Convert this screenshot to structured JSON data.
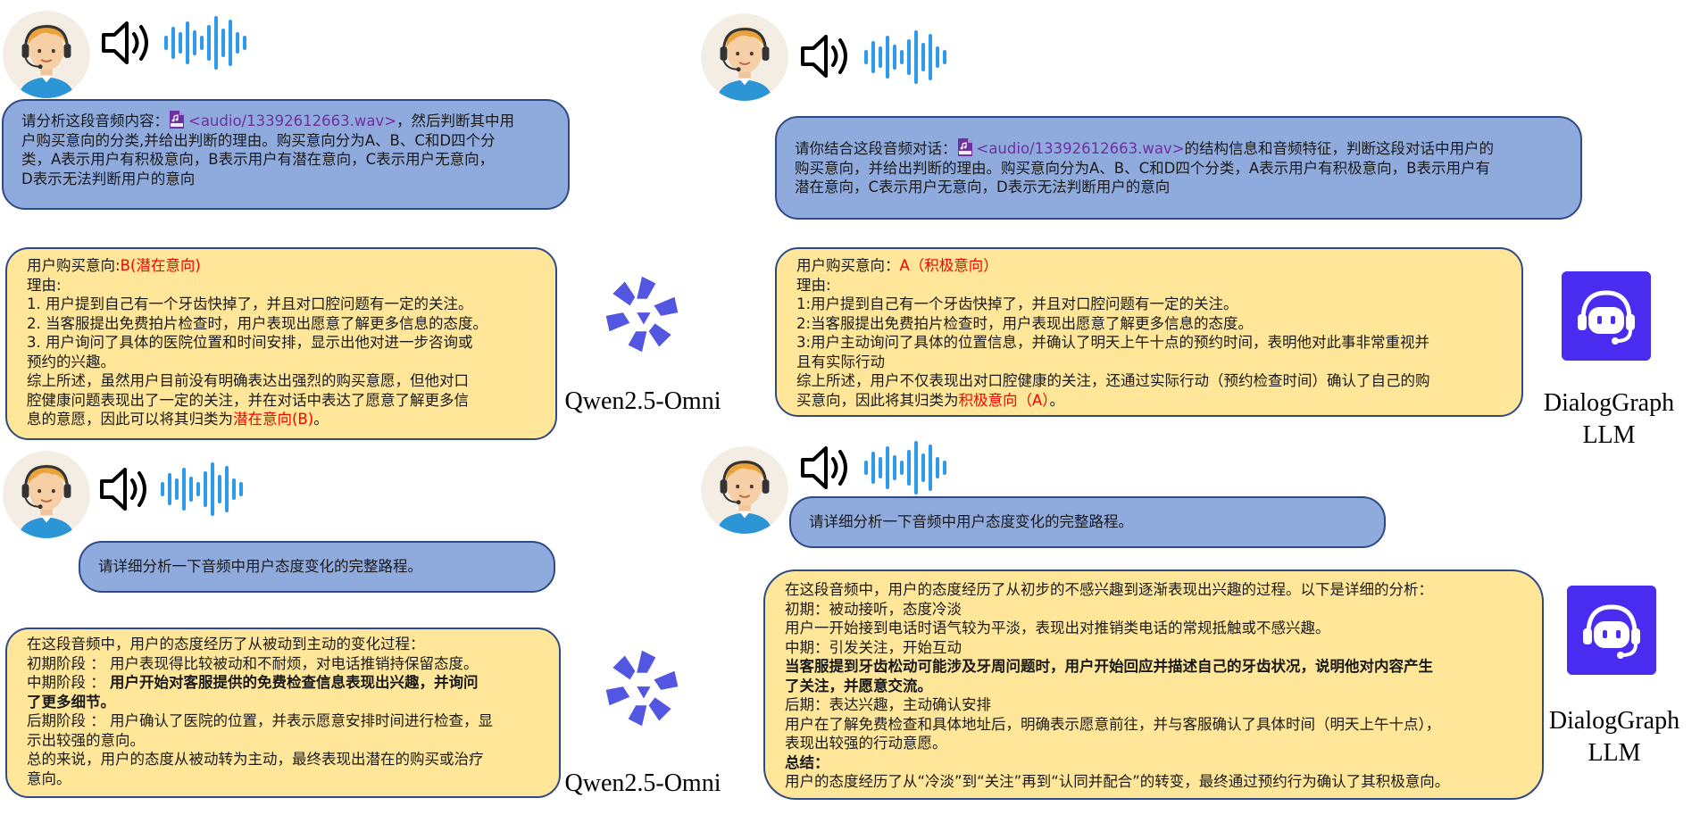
{
  "colors": {
    "question_fill": "#8faadc",
    "answer_fill": "#ffe699",
    "border": "#2f4a86",
    "highlight": "#ff0000",
    "audio_link": "#7030a0",
    "wave": "#2e9bea",
    "dg_logo": "#4a2bf0",
    "qwen_logo": "#5a5be0"
  },
  "icons": {
    "avatar": "headset-agent-avatar-icon",
    "speaker": "speaker-volume-icon",
    "wave": "audio-waveform-icon",
    "audio_file": "wav-file-icon",
    "qwen": "qwen-logo-icon",
    "dialoggraph": "headset-bot-logo-icon"
  },
  "panels": {
    "top_left": {
      "question": {
        "prefix": "请分析这段音频内容：",
        "audio": "<audio/13392612663.wav>",
        "line1_suffix": "，然后判断其中用",
        "lines": [
          "户购买意向的分类,并给出判断的理由。购买意向分为A、B、C和D四个分",
          "类，A表示用户有积极意向，B表示用户有潜在意向，C表示用户无意向，",
          "D表示无法判断用户的意向"
        ]
      },
      "answer": {
        "intent_label": "用户购买意向:",
        "intent_value": "B(潜在意向)",
        "lines": [
          "理由:",
          "1. 用户提到自己有一个牙齿快掉了，并且对口腔问题有一定的关注。",
          "2. 当客服提出免费拍片检查时，用户表现出愿意了解更多信息的态度。",
          "3. 用户询问了具体的医院位置和时间安排，显示出他对进一步咨询或",
          "预约的兴趣。",
          "综上所述，虽然用户目前没有明确表达出强烈的购买意愿，但他对口",
          "腔健康问题表现出了一定的关注，并在对话中表达了愿意了解更多信"
        ],
        "last_prefix": "息的意愿，因此可以将其归类为",
        "last_red": "潜在意向(B)",
        "last_suffix": "。"
      },
      "model": "Qwen2.5-Omni"
    },
    "top_right": {
      "question": {
        "prefix": "请你结合这段音频对话：",
        "audio": "<audio/13392612663.wav>",
        "line1_suffix": "的结构信息和音频特征，判断这段对话中用户的",
        "lines": [
          "购买意向，并给出判断的理由。购买意向分为A、B、C和D四个分类，A表示用户有积极意向，B表示用户有",
          "潜在意向，C表示用户无意向，D表示无法判断用户的意向"
        ]
      },
      "answer": {
        "intent_label": "用户购买意向：",
        "intent_value": "A（积极意向）",
        "lines": [
          "理由:",
          "1:用户提到自己有一个牙齿快掉了，并且对口腔问题有一定的关注。",
          "2:当客服提出免费拍片检查时，用户表现出愿意了解更多信息的态度。",
          "3:用户主动询问了具体的位置信息，并确认了明天上午十点的预约时间，表明他对此事非常重视并",
          "且有实际行动",
          "综上所述，用户不仅表现出对口腔健康的关注，还通过实际行动（预约检查时间）确认了自己的购"
        ],
        "last_prefix": "买意向，因此将其归类为",
        "last_red": "积极意向（A）",
        "last_suffix": "。"
      },
      "model_line1": "DialogGraph",
      "model_line2": "LLM"
    },
    "bottom_left": {
      "question": "请详细分析一下音频中用户态度变化的完整路程。",
      "answer": {
        "l1": "在这段音频中，用户的态度经历了从被动到主动的变化过程：",
        "l2": "初期阶段 ： 用户表现得比较被动和不耐烦，对电话推销持保留态度。",
        "l3_prefix": "中期阶段 ： ",
        "l3_bold": "用户开始对客服提供的免费检查信息表现出兴趣，并询问",
        "l4_bold": "了更多细节。",
        "l5": "后期阶段 ： 用户确认了医院的位置，并表示愿意安排时间进行检查，显",
        "l6": "示出较强的意向。",
        "l7": "总的来说，用户的态度从被动转为主动，最终表现出潜在的购买或治疗",
        "l8": "意向。"
      },
      "model": "Qwen2.5-Omni"
    },
    "bottom_right": {
      "question": "请详细分析一下音频中用户态度变化的完整路程。",
      "answer": {
        "l1": "在这段音频中，用户的态度经历了从初步的不感兴趣到逐渐表现出兴趣的过程。以下是详细的分析：",
        "l2": "初期：被动接听，态度冷淡",
        "l3": "用户一开始接到电话时语气较为平淡，表现出对推销类电话的常规抵触或不感兴趣。",
        "l4": "中期：引发关注，开始互动",
        "l5_bold": "当客服提到牙齿松动可能涉及牙周问题时，用户开始回应并描述自己的牙齿状况，说明他对内容产生",
        "l6_bold": "了关注，并愿意交流。",
        "l7": "后期：表达兴趣，主动确认安排",
        "l8": "用户在了解免费检查和具体地址后，明确表示愿意前往，并与客服确认了具体时间（明天上午十点），",
        "l9": "表现出较强的行动意愿。",
        "l10_bold": "总结：",
        "l11": "用户的态度经历了从“冷淡”到“关注”再到“认同并配合”的转变，最终通过预约行为确认了其积极意向。"
      },
      "model_line1": "DialogGraph",
      "model_line2": "LLM"
    }
  }
}
